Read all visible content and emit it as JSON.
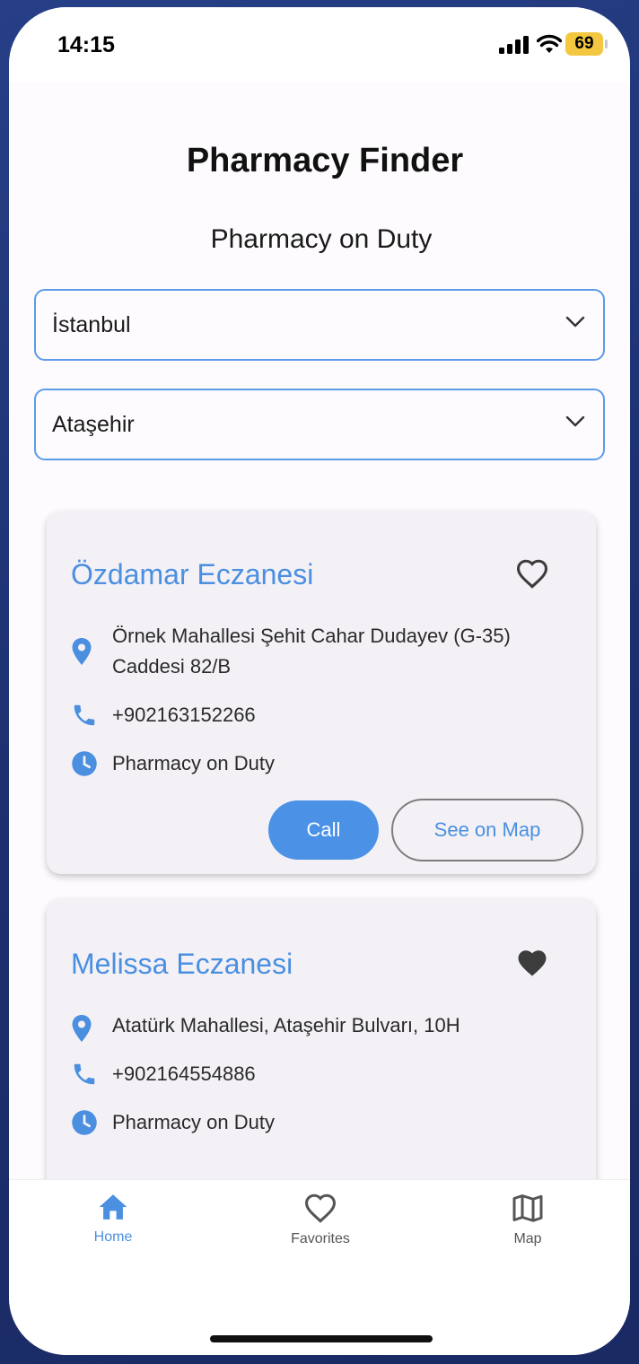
{
  "status_bar": {
    "time": "14:15",
    "battery": "69"
  },
  "header": {
    "title": "Pharmacy Finder",
    "subtitle": "Pharmacy on Duty"
  },
  "filters": {
    "city": "İstanbul",
    "district": "Ataşehir"
  },
  "pharmacies": [
    {
      "name": "Özdamar Eczanesi",
      "address_line1": "Örnek Mahallesi Şehit Cahar Dudayev (G-35)",
      "address_line2": "Caddesi 82/B",
      "phone": "+902163152266",
      "status": "Pharmacy on Duty",
      "favorite": false,
      "call_label": "Call",
      "map_label": "See on Map"
    },
    {
      "name": "Melissa Eczanesi",
      "address_line1": "Atatürk Mahallesi, Ataşehir Bulvarı, 10H",
      "phone": "+902164554886",
      "status": "Pharmacy on Duty",
      "favorite": true
    }
  ],
  "nav": {
    "items": [
      {
        "label": "Home",
        "icon": "home-icon",
        "active": true
      },
      {
        "label": "Favorites",
        "icon": "heart-icon",
        "active": false
      },
      {
        "label": "Map",
        "icon": "map-icon",
        "active": false
      }
    ]
  },
  "colors": {
    "accent": "#4a8fe0",
    "card_bg": "#f4f1f6",
    "border": "#5b9be8"
  }
}
